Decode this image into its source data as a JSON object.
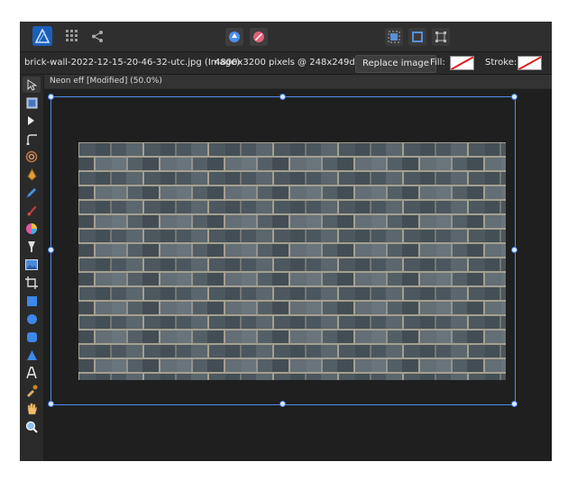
{
  "context_bar": {
    "filename": "brick-wall-2022-12-15-20-46-32-utc.jpg (Image)",
    "dimensions": "4800x3200 pixels @ 248x249dpi",
    "replace_label": "Replace image",
    "fill_label": "Fill:",
    "stroke_label": "Stroke:"
  },
  "document": {
    "tab_label": "Neon eff [Modified] (50.0%)"
  },
  "colors": {
    "accent": "#4f8ff0",
    "app_bg": "#2b2b2b",
    "canvas_bg": "#1f1f1f"
  },
  "toolbar": {
    "tools": [
      "move-tool-icon",
      "artboard-tool-icon",
      "node-tool-icon",
      "corner-tool-icon",
      "spiral-tool-icon",
      "pen-tool-icon",
      "pencil-tool-icon",
      "brush-tool-icon",
      "fill-tool-icon",
      "transparency-tool-icon",
      "image-tool-icon",
      "crop-tool-icon",
      "rectangle-tool-icon",
      "ellipse-tool-icon",
      "rounded-rect-tool-icon",
      "triangle-tool-icon",
      "text-tool-icon",
      "color-picker-icon",
      "hand-tool-icon",
      "zoom-tool-icon"
    ]
  }
}
